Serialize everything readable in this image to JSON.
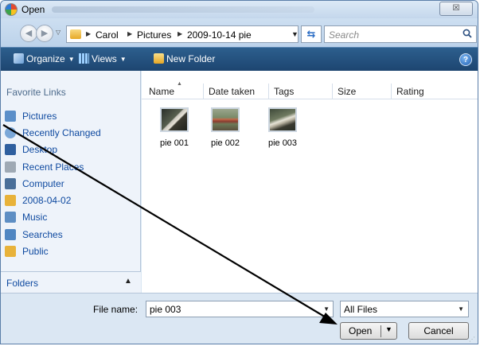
{
  "window": {
    "title": "Open",
    "close_label": "☒"
  },
  "address": {
    "crumbs": [
      "Carol",
      "Pictures",
      "2009-10-14 pie"
    ],
    "search_placeholder": "Search"
  },
  "toolbar": {
    "organize_label": "Organize",
    "views_label": "Views",
    "new_folder_label": "New Folder",
    "help_label": "?"
  },
  "sidebar": {
    "heading": "Favorite Links",
    "items": [
      {
        "label": "Pictures",
        "icon": "pictures-icon",
        "color": "#5b8fc9"
      },
      {
        "label": "Recently Changed",
        "icon": "recently-changed-icon",
        "color": "#7aa7d8"
      },
      {
        "label": "Desktop",
        "icon": "desktop-icon",
        "color": "#2f5f9f"
      },
      {
        "label": "Recent Places",
        "icon": "recent-places-icon",
        "color": "#9fa9b4"
      },
      {
        "label": "Computer",
        "icon": "computer-icon",
        "color": "#4a6f99"
      },
      {
        "label": "2008-04-02",
        "icon": "folder-icon",
        "color": "#e8b23a"
      },
      {
        "label": "Music",
        "icon": "music-icon",
        "color": "#5d8ec4"
      },
      {
        "label": "Searches",
        "icon": "searches-icon",
        "color": "#4f86c2"
      },
      {
        "label": "Public",
        "icon": "folder-icon",
        "color": "#e8b23a"
      }
    ],
    "folders_label": "Folders"
  },
  "filelist": {
    "columns": [
      "Name",
      "Date taken",
      "Tags",
      "Size",
      "Rating"
    ],
    "files": [
      "pie 001",
      "pie 002",
      "pie 003"
    ]
  },
  "bottom": {
    "filename_label": "File name:",
    "filename_value": "pie 003",
    "filetype_value": "All Files",
    "open_label": "Open",
    "cancel_label": "Cancel"
  }
}
